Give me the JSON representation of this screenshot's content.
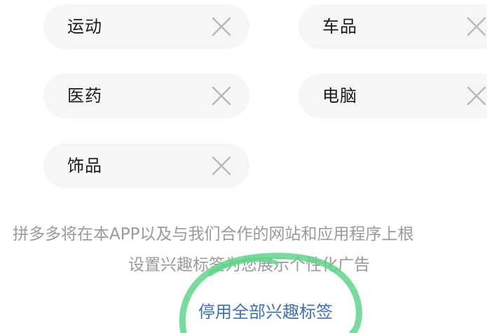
{
  "tags": [
    {
      "label": "运动"
    },
    {
      "label": "车品"
    },
    {
      "label": "医药"
    },
    {
      "label": "电脑"
    },
    {
      "label": "饰品"
    }
  ],
  "notice": {
    "line1": "拼多多将在本APP以及与我们合作的网站和应用程序上根",
    "line2": "设置兴趣标签为您展示个性化广告"
  },
  "disable_link": "停用全部兴趣标签",
  "colors": {
    "tag_bg": "#f6f6f6",
    "link": "#3e74b3",
    "annotation": "#5fd68a"
  },
  "icons": {
    "remove": "close-icon"
  }
}
